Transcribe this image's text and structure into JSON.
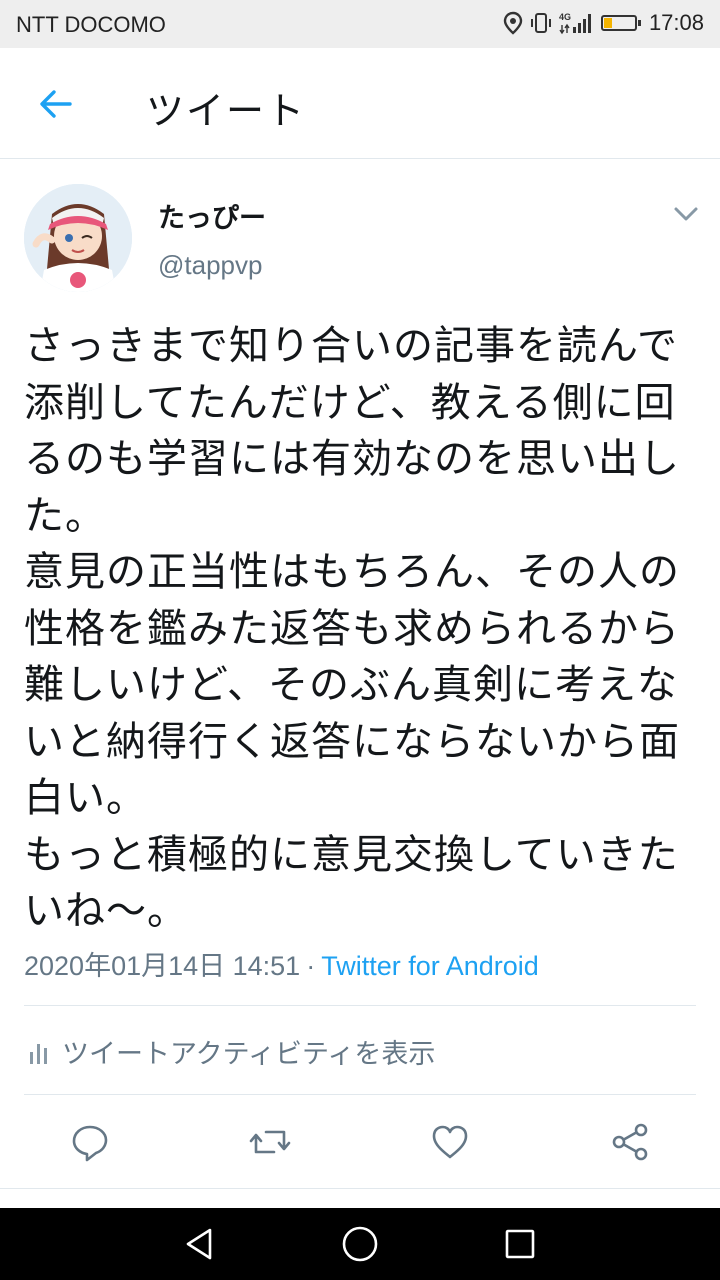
{
  "status_bar": {
    "carrier": "NTT DOCOMO",
    "time": "17:08",
    "network": "4G",
    "battery_percent": 25,
    "icons": [
      "location-icon",
      "vibrate-icon",
      "signal-4g-icon",
      "battery-icon"
    ]
  },
  "header": {
    "title": "ツイート",
    "back_icon": "arrow-left-icon"
  },
  "tweet": {
    "author_name": "たっぴー",
    "author_handle": "@tappvp",
    "text": "さっきまで知り合いの記事を読んで添削してたんだけど、教える側に回るのも学習には有効なのを思い出した。\n意見の正当性はもちろん、その人の性格を鑑みた返答も求められるから難しいけど、そのぶん真剣に考えないと納得行く返答にならないから面白い。\nもっと積極的に意見交換していきたいね〜。",
    "timestamp": "2020年01月14日 14:51",
    "separator": "·",
    "source": "Twitter for Android"
  },
  "activity": {
    "label": "ツイートアクティビティを表示",
    "icon": "analytics-icon"
  },
  "actions": [
    "reply-icon",
    "retweet-icon",
    "like-icon",
    "share-icon"
  ],
  "nav": [
    "back-triangle-icon",
    "home-circle-icon",
    "recents-square-icon"
  ],
  "colors": {
    "accent": "#1da1f2",
    "muted": "#657786",
    "text": "#14171a",
    "status_bar_bg": "#eeeeee",
    "nav_bar_bg": "#000000"
  }
}
